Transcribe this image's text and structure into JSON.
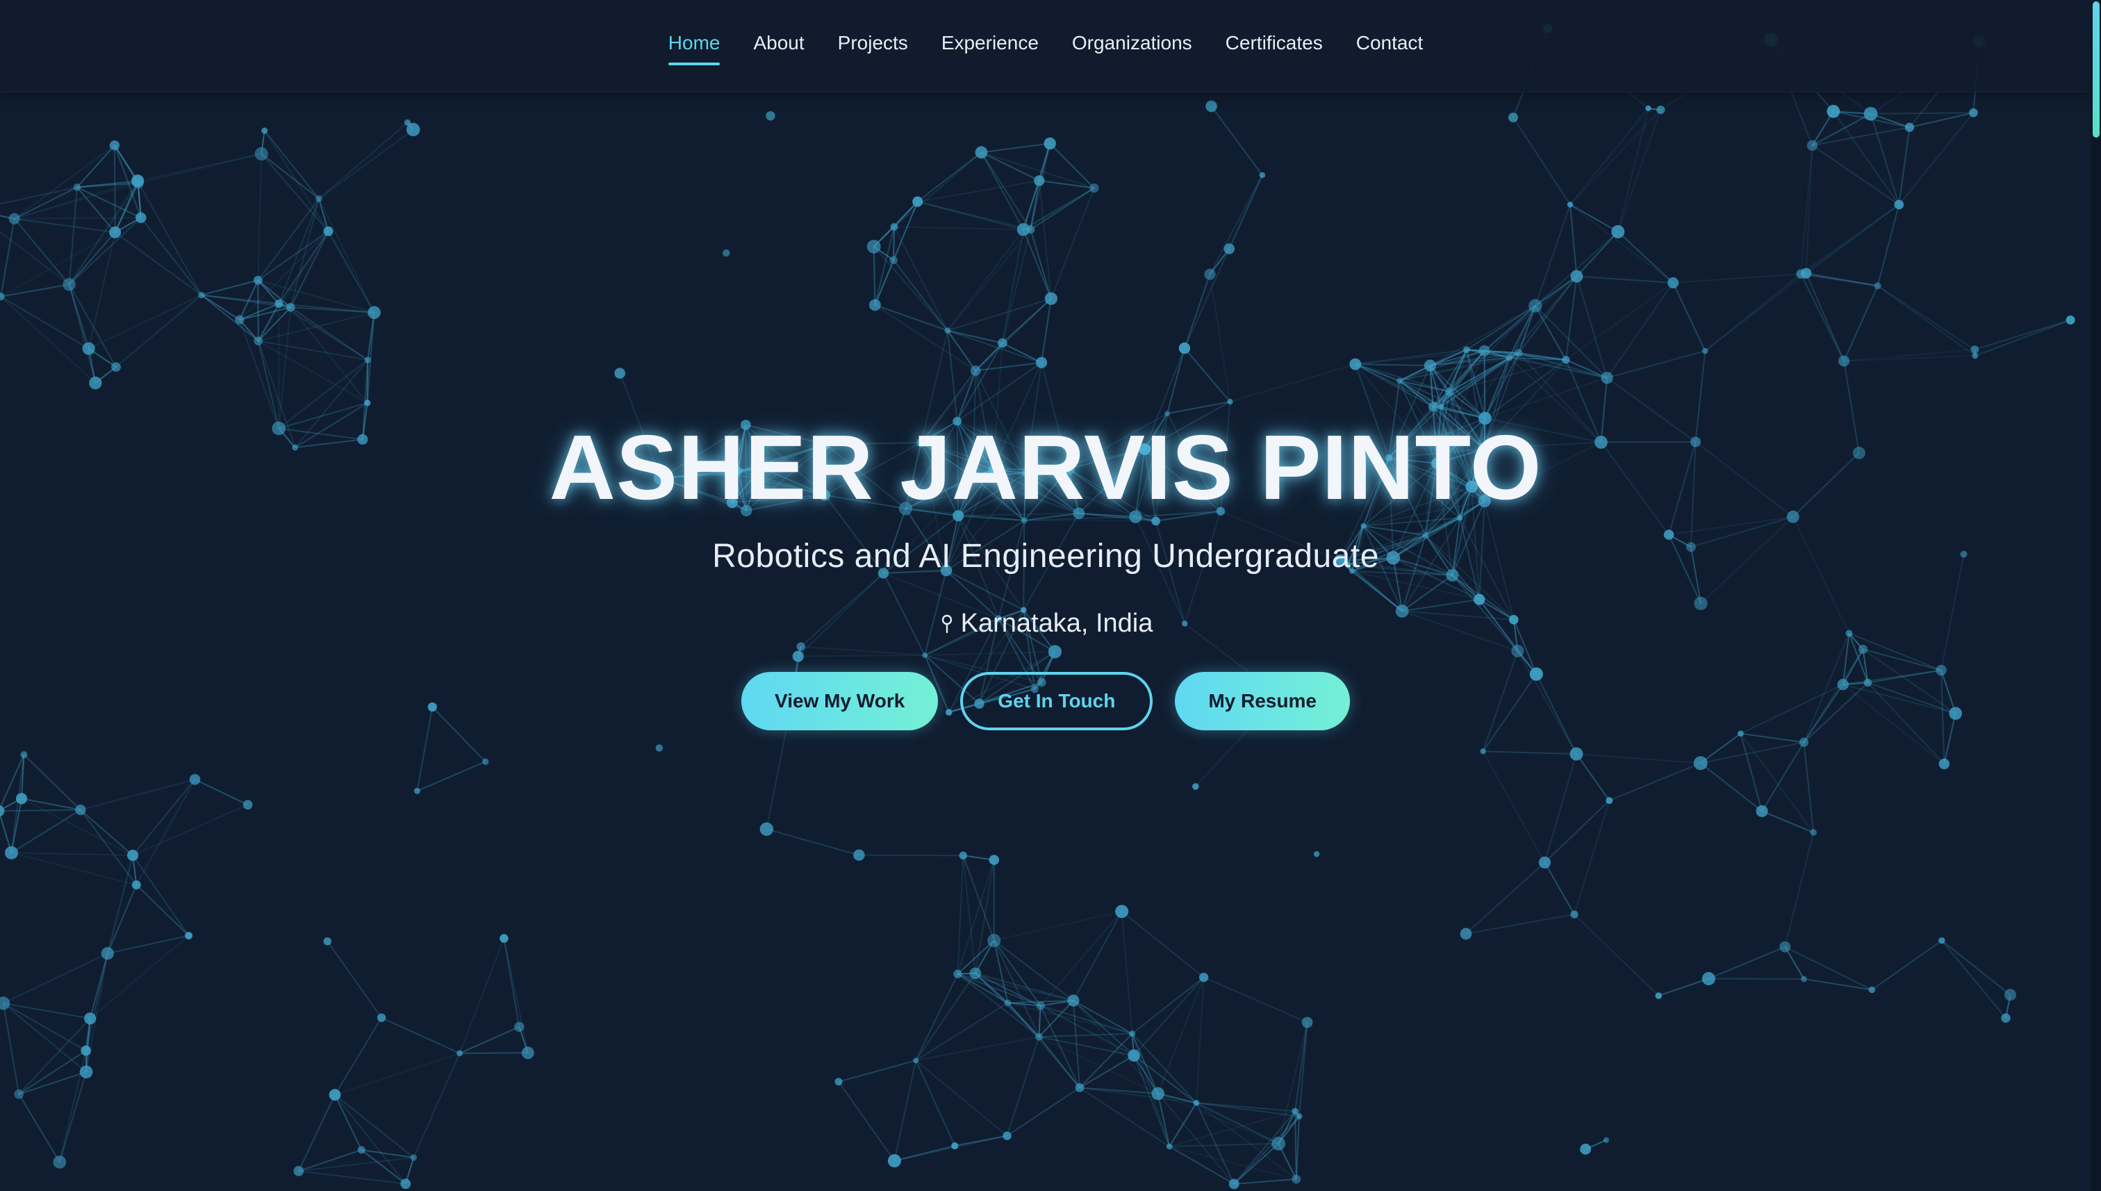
{
  "nav": {
    "items": [
      {
        "label": "Home",
        "active": true
      },
      {
        "label": "About",
        "active": false
      },
      {
        "label": "Projects",
        "active": false
      },
      {
        "label": "Experience",
        "active": false
      },
      {
        "label": "Organizations",
        "active": false
      },
      {
        "label": "Certificates",
        "active": false
      },
      {
        "label": "Contact",
        "active": false
      }
    ]
  },
  "hero": {
    "name": "ASHER JARVIS PINTO",
    "subtitle": "Robotics and AI Engineering Undergraduate",
    "location": "Karnataka, India",
    "location_icon": "map-pin-icon",
    "buttons": {
      "view_work": "View My Work",
      "get_in_touch": "Get In Touch",
      "resume": "My Resume"
    }
  },
  "colors": {
    "background": "#101d30",
    "accent": "#5fd4ee",
    "accent_alt": "#74f0d6",
    "network": "#3f9fc4",
    "text": "#f2f6fb"
  }
}
